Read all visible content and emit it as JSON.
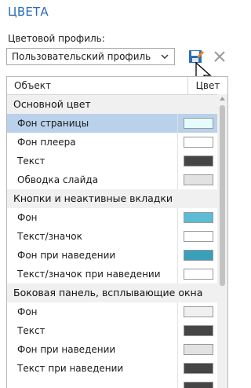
{
  "title": "ЦВЕТА",
  "profile_label": "Цветовой профиль:",
  "profile_select": {
    "value": "Пользовательский профиль"
  },
  "table": {
    "col_object": "Объект",
    "col_color": "Цвет",
    "groups": [
      {
        "name": "Основной цвет",
        "items": [
          {
            "label": "Фон страницы",
            "color": "#e6fbfc",
            "selected": true
          },
          {
            "label": "Фон плеера",
            "color": "#ffffff"
          },
          {
            "label": "Текст",
            "color": "#454545"
          },
          {
            "label": "Обводка слайда",
            "color": "#e2e2e2"
          }
        ]
      },
      {
        "name": "Кнопки и неактивные вкладки",
        "items": [
          {
            "label": "Фон",
            "color": "#5bbcd6"
          },
          {
            "label": "Текст/значок",
            "color": "#ffffff"
          },
          {
            "label": "Фон при наведении",
            "color": "#3a9fb8"
          },
          {
            "label": "Текст/значок при наведении",
            "color": "#ffffff"
          }
        ]
      },
      {
        "name": "Боковая панель, всплывающие окна",
        "items": [
          {
            "label": "Фон",
            "color": "#f0f0f0"
          },
          {
            "label": "Текст",
            "color": "#454545"
          },
          {
            "label": "Фон при наведении",
            "color": "#e2e2e2"
          },
          {
            "label": "Текст при наведении",
            "color": "#454545"
          },
          {
            "label": "",
            "color": "#454545"
          }
        ]
      }
    ]
  },
  "colors": {
    "accent": "#2b6cb8",
    "selection": "#b9d1ea",
    "save_icon_blue": "#2c6fb7",
    "save_icon_orange": "#e8822a"
  }
}
